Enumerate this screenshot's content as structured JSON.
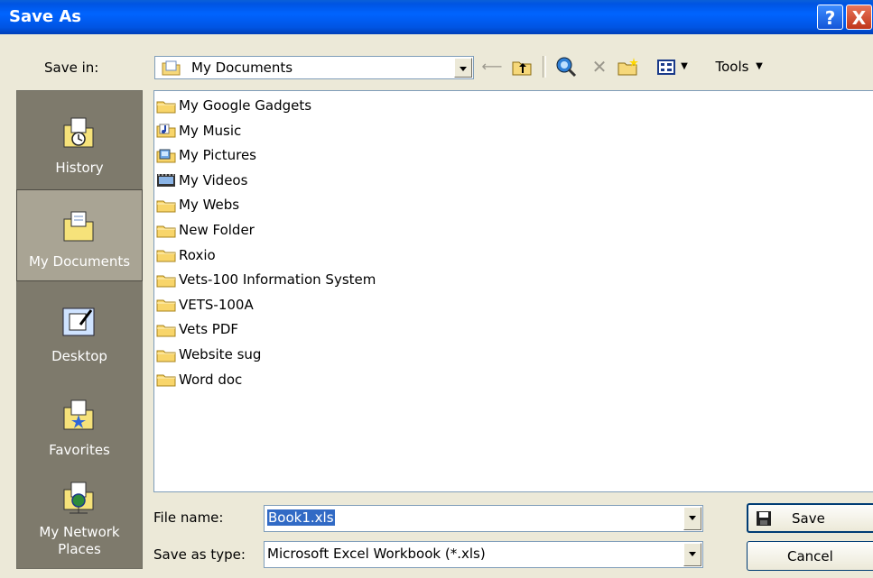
{
  "window": {
    "title": "Save As"
  },
  "titlebar": {
    "help_label": "?",
    "close_label": "X"
  },
  "toolbar": {
    "save_in_label": "Save in:",
    "save_in_value": "My Documents",
    "tools_label": "Tools"
  },
  "places": [
    {
      "label": "History"
    },
    {
      "label": "My Documents"
    },
    {
      "label": "Desktop"
    },
    {
      "label": "Favorites"
    },
    {
      "label": "My Network Places"
    }
  ],
  "files": [
    {
      "name": "My Google Gadgets",
      "icon": "folder-icon"
    },
    {
      "name": "My Music",
      "icon": "music-folder-icon"
    },
    {
      "name": "My Pictures",
      "icon": "pictures-folder-icon"
    },
    {
      "name": "My Videos",
      "icon": "videos-folder-icon"
    },
    {
      "name": "My Webs",
      "icon": "folder-icon"
    },
    {
      "name": "New Folder",
      "icon": "folder-icon"
    },
    {
      "name": "Roxio",
      "icon": "folder-icon"
    },
    {
      "name": "Vets-100 Information System",
      "icon": "folder-icon"
    },
    {
      "name": "VETS-100A",
      "icon": "folder-icon"
    },
    {
      "name": "Vets PDF",
      "icon": "folder-icon"
    },
    {
      "name": "Website sug",
      "icon": "folder-icon"
    },
    {
      "name": "Word doc",
      "icon": "folder-icon"
    }
  ],
  "footer": {
    "file_name_label": "File name:",
    "file_name_value": "Book1.xls",
    "save_type_label": "Save as type:",
    "save_type_value": "Microsoft Excel Workbook (*.xls)",
    "save_label": "Save",
    "cancel_label": "Cancel"
  },
  "colors": {
    "titlebar": "#0054e3",
    "dialog_bg": "#ece9d8",
    "places_bg": "#7e7a6c",
    "selection": "#316ac5"
  }
}
